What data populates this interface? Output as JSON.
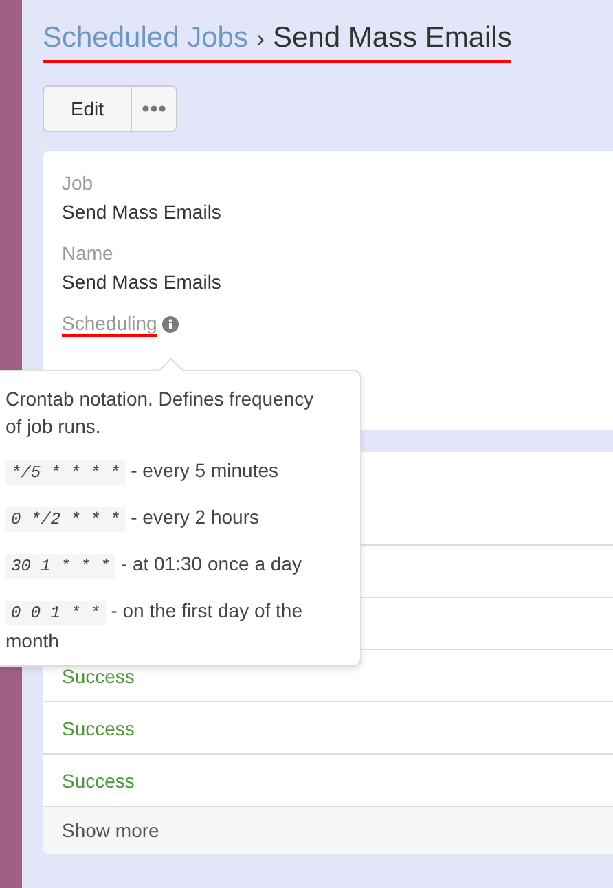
{
  "breadcrumb": {
    "parent": "Scheduled Jobs",
    "separator": "›",
    "current": "Send Mass Emails",
    "underlined": true
  },
  "actions": {
    "edit": "Edit"
  },
  "fields": [
    {
      "label": "Job",
      "value": "Send Mass Emails",
      "underlined": false
    },
    {
      "label": "Name",
      "value": "Send Mass Emails",
      "underlined": false
    },
    {
      "label": "Scheduling",
      "info": true,
      "underlined": true
    }
  ],
  "tooltip": {
    "intro": "Crontab notation. Defines frequency of job runs.",
    "examples": [
      {
        "code": "*/5 * * * *",
        "description": "- every 5 minutes"
      },
      {
        "code": "0 */2 * * *",
        "description": "- every 2 hours"
      },
      {
        "code": "30 1 * * *",
        "description": "- at 01:30 once a day"
      },
      {
        "code": "0 0 1 * *",
        "description": "- on the first day of the month"
      }
    ]
  },
  "runs": [
    {
      "status": "Success",
      "kind": "success"
    },
    {
      "status": "Success",
      "kind": "success"
    },
    {
      "status": "Success",
      "kind": "success"
    }
  ],
  "show_more": "Show more"
}
